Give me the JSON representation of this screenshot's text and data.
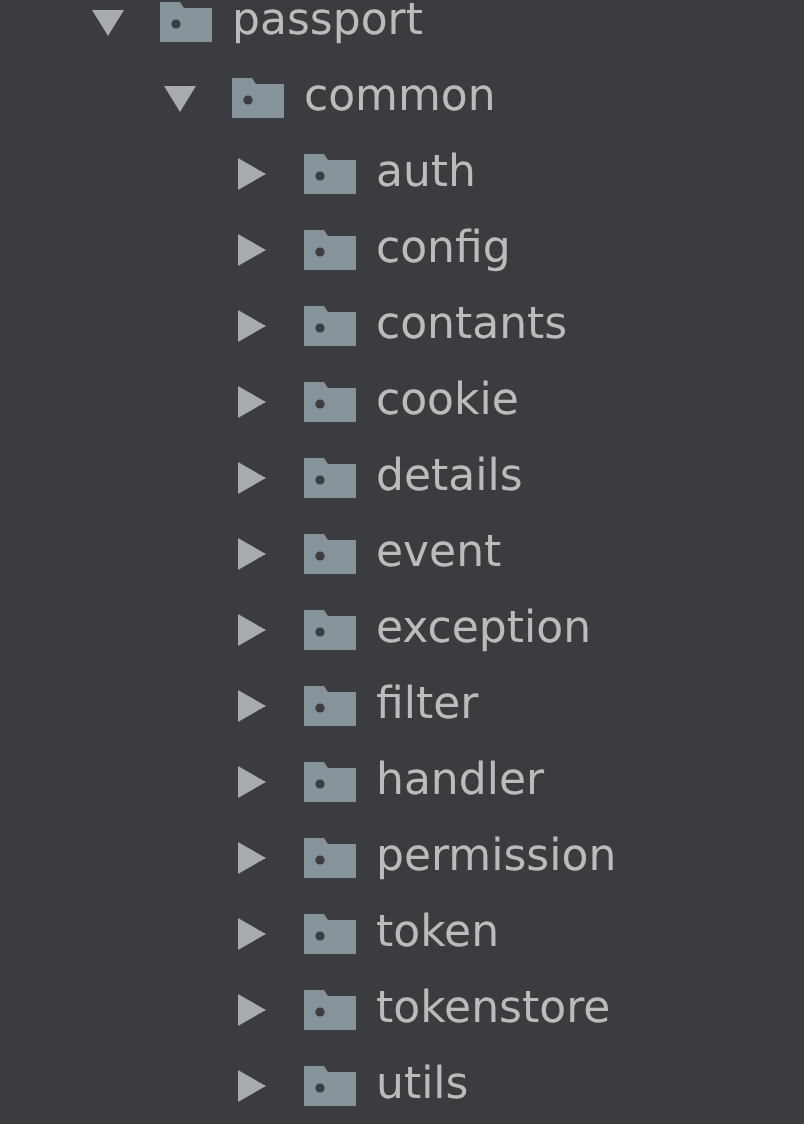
{
  "tree": [
    {
      "name": "passport",
      "expanded": true,
      "children": [
        {
          "name": "common",
          "expanded": true,
          "children": [
            {
              "name": "auth",
              "expanded": false
            },
            {
              "name": "config",
              "expanded": false
            },
            {
              "name": "contants",
              "expanded": false
            },
            {
              "name": "cookie",
              "expanded": false
            },
            {
              "name": "details",
              "expanded": false
            },
            {
              "name": "event",
              "expanded": false
            },
            {
              "name": "exception",
              "expanded": false
            },
            {
              "name": "filter",
              "expanded": false
            },
            {
              "name": "handler",
              "expanded": false
            },
            {
              "name": "permission",
              "expanded": false
            },
            {
              "name": "token",
              "expanded": false
            },
            {
              "name": "tokenstore",
              "expanded": false
            },
            {
              "name": "utils",
              "expanded": false
            }
          ]
        }
      ]
    }
  ]
}
